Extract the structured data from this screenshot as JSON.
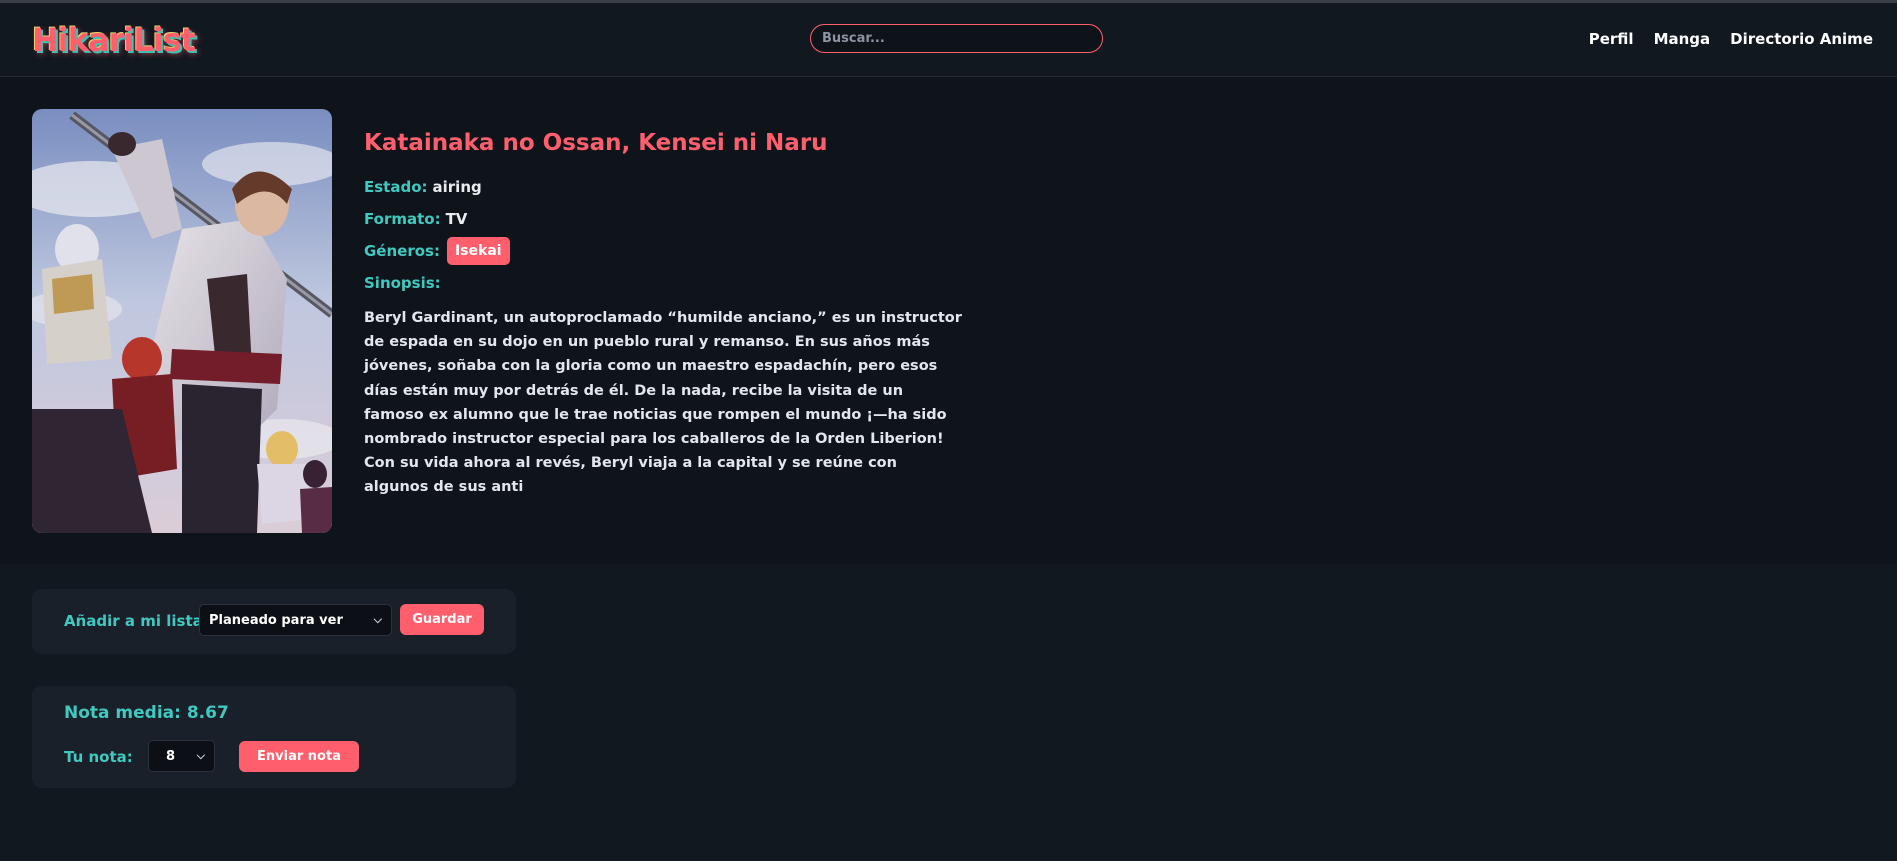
{
  "header": {
    "logo": "HikariList",
    "search_placeholder": "Buscar...",
    "nav": [
      {
        "label": "Perfil"
      },
      {
        "label": "Manga"
      },
      {
        "label": "Directorio Anime"
      }
    ]
  },
  "anime": {
    "title": "Katainaka no Ossan, Kensei ni Naru",
    "status_label": "Estado:",
    "status": "airing",
    "format_label": "Formato:",
    "format": "TV",
    "genres_label": "Géneros:",
    "genres": [
      "Isekai"
    ],
    "synopsis_label": "Sinopsis:",
    "synopsis": "Beryl Gardinant, un autoproclamado “humilde anciano,” es un instructor de espada en su dojo en un pueblo rural y remanso. En sus años más jóvenes, soñaba con la gloria como un maestro espadachín, pero esos días están muy por detrás de él. De la nada, recibe la visita de un famoso ex alumno que le trae noticias que rompen el mundo ¡—ha sido nombrado instructor especial para los caballeros de la Orden Liberion! Con su vida ahora al revés, Beryl viaja a la capital y se reúne con algunos de sus anti"
  },
  "list_card": {
    "label": "Añadir a mi lista:",
    "selected": "Planeado para ver",
    "save": "Guardar"
  },
  "rating_card": {
    "average": "Nota media: 8.67",
    "your_label": "Tu nota:",
    "your_value": "8",
    "submit": "Enviar nota"
  },
  "colors": {
    "accent": "#ff5f6d",
    "teal": "#40c9c0",
    "background": "#0f141b",
    "card": "#1a2029"
  },
  "icons": {
    "dropdown": "chevron-down-icon"
  }
}
